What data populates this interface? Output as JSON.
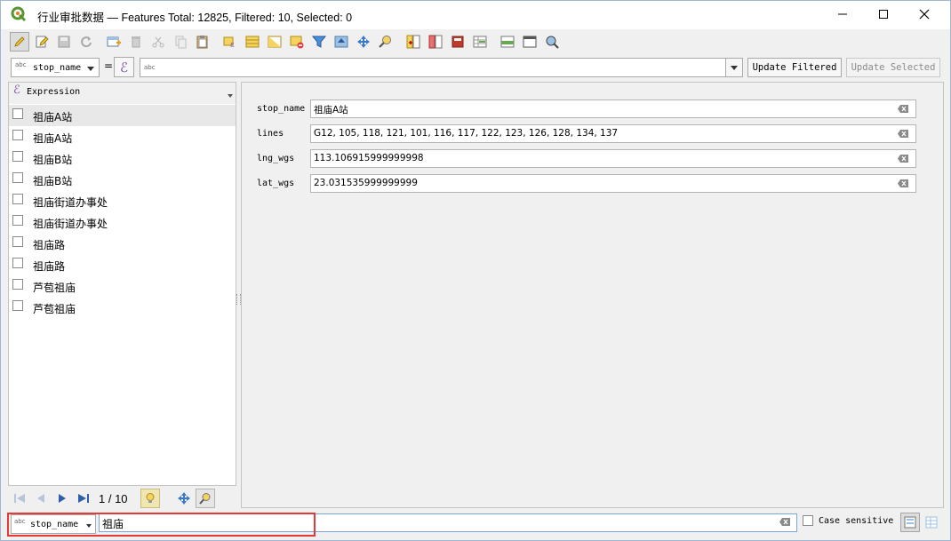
{
  "window": {
    "title": "行业审批数据 — Features Total: 12825, Filtered: 10, Selected: 0"
  },
  "toolbar": {
    "icons": [
      "edit-pencil-icon",
      "multi-edit-icon",
      "save-icon",
      "reload-icon",
      "add-feature-icon",
      "delete-icon",
      "cut-icon",
      "copy-icon",
      "paste-icon",
      "expression-select-icon",
      "select-all-icon",
      "invert-selection-icon",
      "deselect-icon",
      "filter-icon",
      "move-top-icon",
      "pan-icon",
      "zoom-icon",
      "new-field-icon",
      "delete-field-icon",
      "field-calculator-icon",
      "conditional-format-icon",
      "dock-icon",
      "table-view-icon",
      "actions-icon"
    ]
  },
  "filter": {
    "field_abc": "abc",
    "field": "stop_name",
    "operator": "=",
    "expression_abc": "abc",
    "update_filtered": "Update Filtered",
    "update_selected": "Update Selected"
  },
  "preview": {
    "epsilon": "ℰ",
    "label": "Expression"
  },
  "list": {
    "items": [
      "祖庙A站",
      "祖庙A站",
      "祖庙B站",
      "祖庙B站",
      "祖庙街道办事处",
      "祖庙街道办事处",
      "祖庙路",
      "祖庙路",
      "芦苞祖庙",
      "芦苞祖庙"
    ]
  },
  "nav": {
    "page_text": "1 / 10"
  },
  "form": {
    "fields": [
      {
        "label": "stop_name",
        "value": "祖庙A站"
      },
      {
        "label": "lines",
        "value": "G12, 105, 118, 121, 101, 116, 117, 122, 123, 126, 128, 134, 137"
      },
      {
        "label": "lng_wgs",
        "value": "113.106915999999998"
      },
      {
        "label": "lat_wgs",
        "value": "23.031535999999999"
      }
    ]
  },
  "quick_search": {
    "field_abc": "abc",
    "field": "stop_name",
    "value": "祖庙",
    "case_label": "Case sensitive"
  },
  "colors": {
    "highlight": "#e53935",
    "titlebar": "#ffffff",
    "panel": "#f0f0f0"
  }
}
